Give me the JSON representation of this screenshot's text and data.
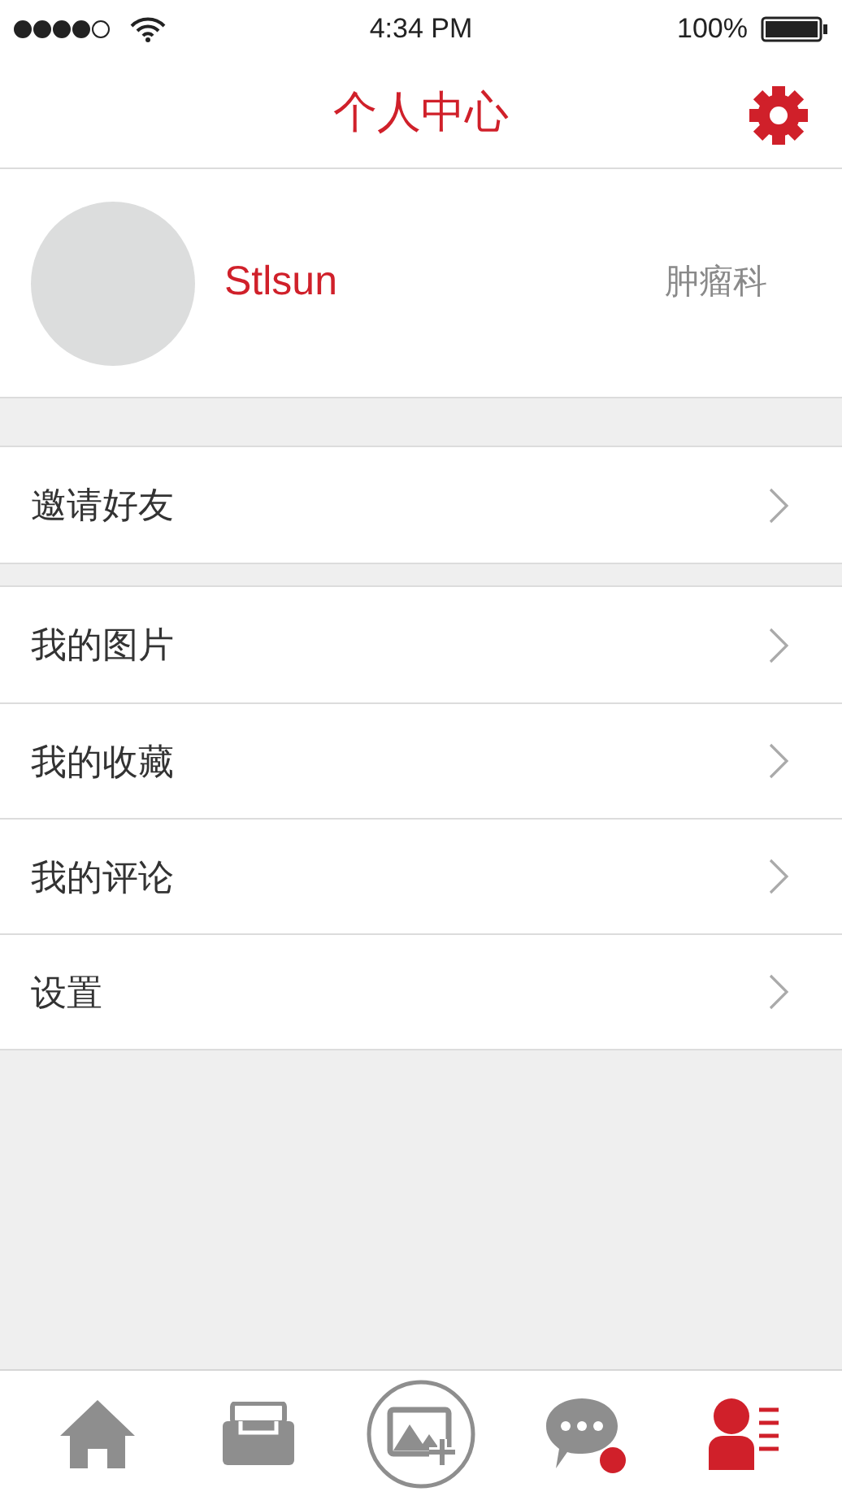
{
  "status_bar": {
    "time": "4:34 PM",
    "battery": "100%"
  },
  "header": {
    "title": "个人中心"
  },
  "profile": {
    "name": "Stlsun",
    "department": "肿瘤科"
  },
  "menu_groups": [
    [
      {
        "label": "邀请好友"
      }
    ],
    [
      {
        "label": "我的图片"
      },
      {
        "label": "我的收藏"
      },
      {
        "label": "我的评论"
      },
      {
        "label": "设置"
      }
    ]
  ],
  "tab_bar": [
    {
      "kind": "home",
      "selected": false,
      "badge": false
    },
    {
      "kind": "inbox",
      "selected": false,
      "badge": false
    },
    {
      "kind": "add-photo",
      "selected": false,
      "badge": false
    },
    {
      "kind": "messages",
      "selected": false,
      "badge": true
    },
    {
      "kind": "profile",
      "selected": true,
      "badge": false
    }
  ]
}
